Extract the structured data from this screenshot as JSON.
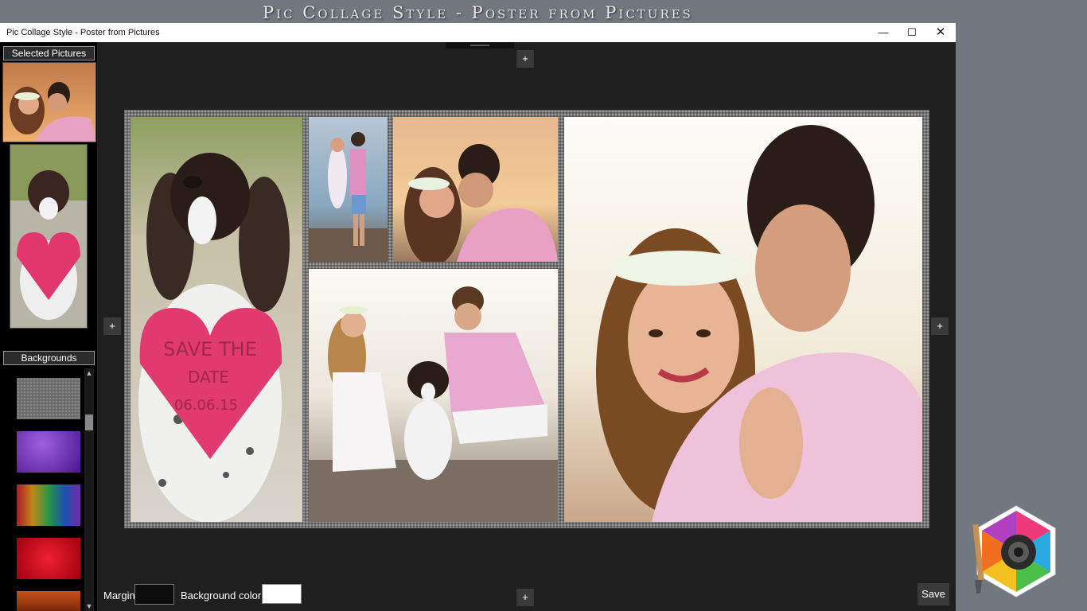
{
  "banner": {
    "title": "Pic Collage Style - Poster from Pictures"
  },
  "window": {
    "title": "Pic Collage Style - Poster from Pictures",
    "minimize_glyph": "—",
    "maximize_glyph": "☐",
    "close_glyph": "✕"
  },
  "sidebar": {
    "selected_header": "Selected Pictures",
    "backgrounds_header": "Backgrounds",
    "scroll_up_glyph": "▲",
    "scroll_down_glyph": "▼",
    "swatches": [
      {
        "name": "gray-granite",
        "color": "#666666"
      },
      {
        "name": "purple-texture",
        "color": "#6a2fb0"
      },
      {
        "name": "rainbow-mosaic",
        "color": "#3a6fd0"
      },
      {
        "name": "red-texture",
        "color": "#d41020"
      },
      {
        "name": "orange-brown",
        "color": "#a8400e"
      }
    ]
  },
  "canvas": {
    "add_glyph": "+"
  },
  "bottom": {
    "margin_label": "Margin",
    "bg_color_label": "Background color",
    "bg_color_value": "#ffffff",
    "save_label": "Save"
  },
  "collage": {
    "photos": [
      {
        "name": "dog-heart-photo",
        "heart_text_line1": "SAVE THE",
        "heart_text_line2": "DATE",
        "heart_text_line3": "06.06.15"
      },
      {
        "name": "couple-beach-small-photo"
      },
      {
        "name": "couple-sunset-photo"
      },
      {
        "name": "couple-with-dog-photo"
      },
      {
        "name": "couple-closeup-photo"
      }
    ]
  }
}
